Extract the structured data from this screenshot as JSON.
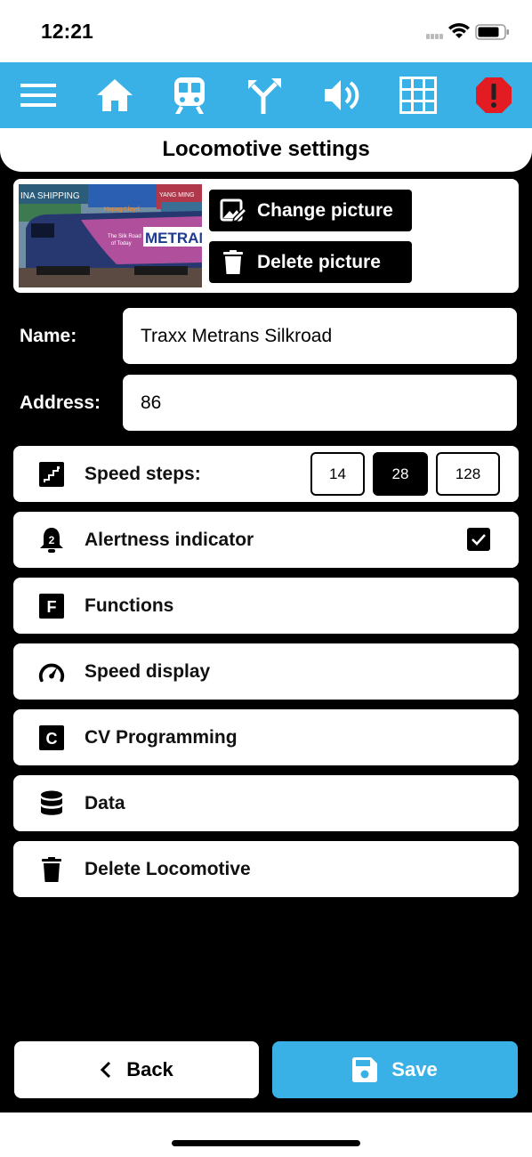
{
  "status_bar": {
    "time": "12:21"
  },
  "toolbar": {
    "items": [
      "menu-icon",
      "home-icon",
      "train-icon",
      "switch-icon",
      "sound-icon",
      "grid-icon",
      "emergency-stop-icon"
    ],
    "color": "#3ab1e6"
  },
  "title": "Locomotive settings",
  "picture": {
    "change_label": "Change picture",
    "delete_label": "Delete picture"
  },
  "fields": {
    "name_label": "Name:",
    "name_value": "Traxx Metrans Silkroad",
    "address_label": "Address:",
    "address_value": "86"
  },
  "speed_steps": {
    "label": "Speed steps:",
    "options": [
      "14",
      "28",
      "128"
    ],
    "selected": "28"
  },
  "alertness": {
    "label": "Alertness indicator",
    "checked": true
  },
  "rows": {
    "functions": "Functions",
    "speed_display": "Speed display",
    "cv_programming": "CV Programming",
    "data": "Data",
    "delete_locomotive": "Delete Locomotive"
  },
  "icon_letters": {
    "functions": "F",
    "cv": "C",
    "alert": "2"
  },
  "buttons": {
    "back": "Back",
    "save": "Save"
  },
  "image_text": {
    "container1": "INA SHIPPING",
    "container2": "YANG MING",
    "container3": "Hapag-Lloyd",
    "loco_brand": "METRAN",
    "loco_slogan1": "The Silk Road",
    "loco_slogan2": "of Today"
  }
}
